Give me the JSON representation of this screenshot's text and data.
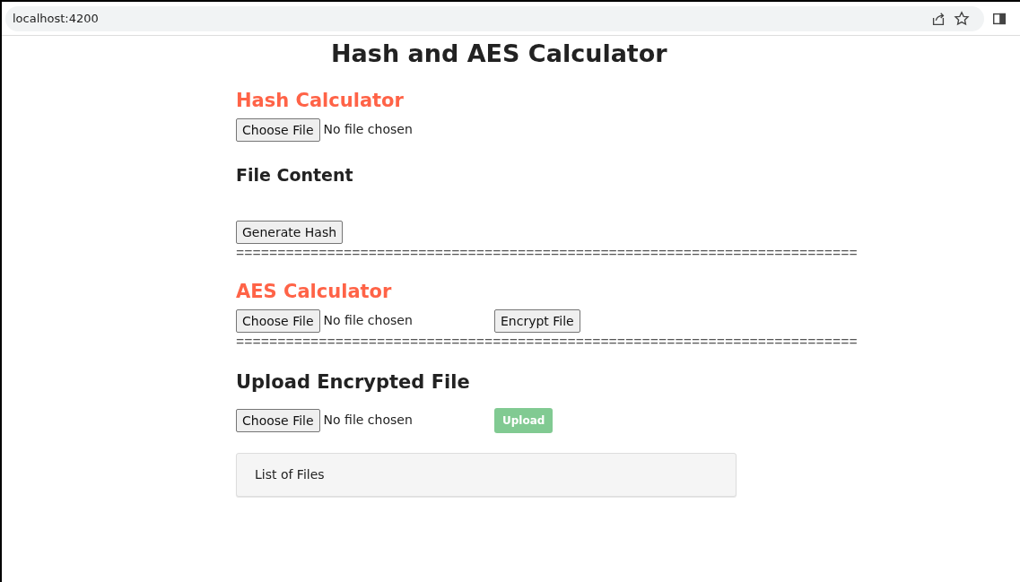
{
  "browser": {
    "address": "localhost:4200"
  },
  "title": "Hash and AES Calculator",
  "hash_section": {
    "heading": "Hash Calculator",
    "file_input": {
      "button": "Choose File",
      "status": "No file chosen"
    },
    "content_heading": "File Content",
    "button": "Generate Hash"
  },
  "separator_1": "===========================================================================",
  "aes_section": {
    "heading": "AES Calculator",
    "file_input": {
      "button": "Choose File",
      "status": "No file chosen"
    },
    "button": "Encrypt File"
  },
  "separator_2": "===========================================================================",
  "upload_section": {
    "heading": "Upload Encrypted File",
    "file_input": {
      "button": "Choose File",
      "status": "No file chosen"
    },
    "button": {
      "label": "Upload",
      "disabled": true
    }
  },
  "files_panel": {
    "heading": "List of Files"
  }
}
